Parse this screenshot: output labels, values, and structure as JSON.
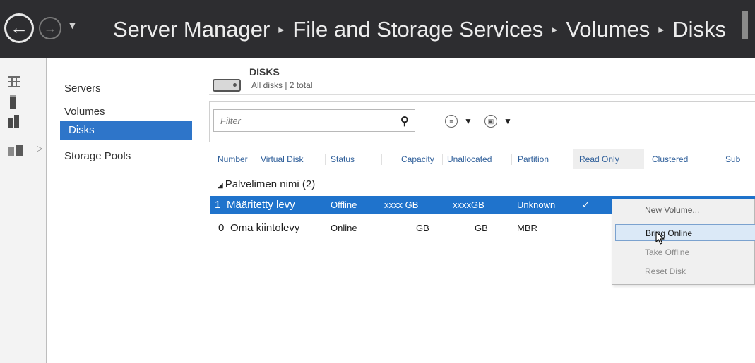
{
  "titlebar": {
    "back_icon": "back-arrow-icon",
    "forward_icon": "forward-arrow-icon",
    "dropdown_icon": "chevron-down-icon",
    "breadcrumb": [
      "Server Manager",
      "File and Storage Services",
      "Volumes",
      "Disks"
    ],
    "separator": "▸"
  },
  "rail": {
    "icons": [
      "dashboard-icon",
      "local-server-icon",
      "all-servers-icon",
      "file-storage-icon"
    ]
  },
  "subnav": {
    "items": [
      {
        "label": "Servers"
      },
      {
        "label": "Volumes"
      },
      {
        "label": "Disks",
        "selected": true
      },
      {
        "label": "Storage Pools"
      }
    ]
  },
  "section": {
    "title": "DISKS",
    "subtitle": "All disks | 2 total"
  },
  "filter": {
    "placeholder": "Filter"
  },
  "table": {
    "columns": [
      "Number",
      "Virtual Disk",
      "Status",
      "Capacity",
      "Unallocated",
      "Partition",
      "Read Only",
      "Clustered",
      "Sub"
    ],
    "group": {
      "name": "Palvelimen nimi",
      "count": "(2)"
    },
    "rows": [
      {
        "number": "1",
        "name": "Määritetty levy",
        "status": "Offline",
        "capacity": "xxxx  GB",
        "unallocated": "xxxxGB",
        "partition": "Unknown",
        "read_only": "✓",
        "selected": true
      },
      {
        "number": "0",
        "name": "Oma kiintolevy",
        "status": "Online",
        "capacity": "GB",
        "unallocated": "GB",
        "partition": "MBR",
        "read_only": "",
        "selected": false
      }
    ]
  },
  "context_menu": {
    "items": [
      "New Volume...",
      "Bring Online",
      "Take Offline",
      "Reset Disk"
    ],
    "hovered": "Bring Online"
  },
  "colors": {
    "titlebar_bg": "#2d2d30",
    "selection_blue": "#1f73cc",
    "nav_selected": "#2e75c9",
    "header_text": "#2f5f9a"
  }
}
